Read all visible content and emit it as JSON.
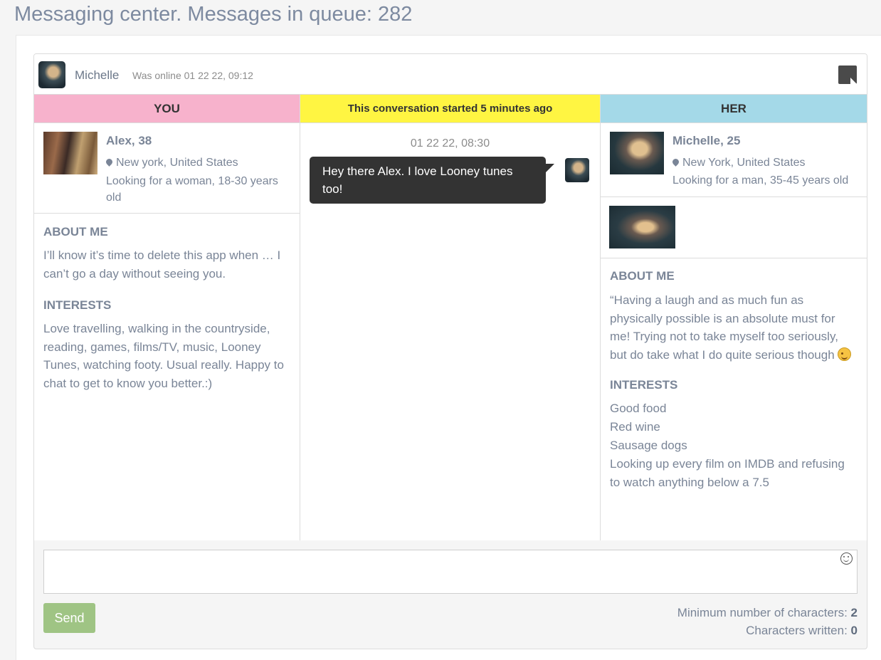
{
  "page": {
    "title": "Messaging center. Messages in queue: 282"
  },
  "header": {
    "name": "Michelle",
    "status": "Was online  01 22 22, 09:12",
    "note_icon": "sticky-note-icon"
  },
  "columns": {
    "you_label": "YOU",
    "middle_label": "This conversation started 5 minutes ago",
    "her_label": "HER"
  },
  "you": {
    "name": "Alex, 38",
    "location": "New york, United States",
    "seeking": "Looking for a woman, 18-30 years old",
    "about_title": "ABOUT ME",
    "about_text": "I’ll know it’s time to delete this app when … I can’t go a day without seeing you.",
    "interests_title": "INTERESTS",
    "interests_text": "Love travelling, walking in the countryside, reading, games, films/TV, music, Looney Tunes, watching footy. Usual really. Happy to chat to get to know you better.:)"
  },
  "conversation": {
    "messages": [
      {
        "time": "01 22 22, 08:30",
        "text": "Hey there Alex. I love Looney tunes too!"
      }
    ]
  },
  "her": {
    "name": "Michelle, 25",
    "location": "New York, United States",
    "seeking": "Looking for a man, 35-45 years old",
    "about_title": "ABOUT ME",
    "about_text": "“Having a laugh and as much fun as physically possible is an absolute must for me! Trying not to take myself too seriously, but do take what I do quite serious though",
    "interests_title": "INTERESTS",
    "interests": [
      "Good food",
      "Red wine",
      "Sausage dogs",
      "Looking up every film on IMDB and refusing to watch anything below a 7.5"
    ]
  },
  "compose": {
    "send_label": "Send",
    "min_chars_label": "Minimum number of characters: ",
    "min_chars_value": "2",
    "written_label": "Characters written: ",
    "written_value": "0"
  }
}
